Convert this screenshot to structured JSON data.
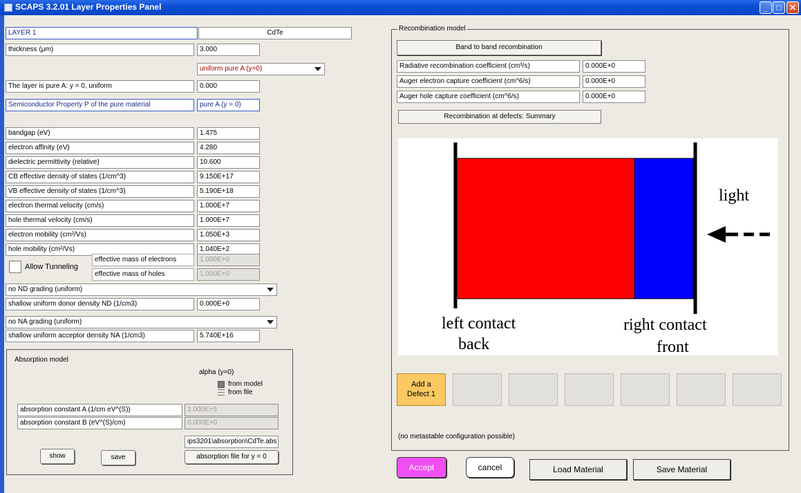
{
  "window": {
    "title": "SCAPS 3.2.01 Layer Properties Panel"
  },
  "layer": {
    "name": "LAYER 1",
    "material": "CdTe",
    "thickness_label": "thickness (μm)",
    "thickness_value": "3.000",
    "composition_select": "uniform pure A (y=0)",
    "pure_a_label": "The layer is pure A: y = 0, uniform",
    "pure_a_value": "0.000",
    "semiconductor_label": "Semiconductor Property P of the pure material",
    "semiconductor_value": "pure A (y = 0)"
  },
  "properties": [
    {
      "label": "bandgap (eV)",
      "value": "1.475"
    },
    {
      "label": "electron affinity (eV)",
      "value": "4.280"
    },
    {
      "label": "dielectric permittivity (relative)",
      "value": "10.600"
    },
    {
      "label": "CB effective density of states (1/cm^3)",
      "value": "9.150E+17"
    },
    {
      "label": "VB effective density of states (1/cm^3)",
      "value": "5.190E+18"
    },
    {
      "label": "electron thermal velocity (cm/s)",
      "value": "1.000E+7"
    },
    {
      "label": "hole thermal velocity (cm/s)",
      "value": "1.000E+7"
    },
    {
      "label": "electron mobility (cm²/Vs)",
      "value": "1.050E+3"
    },
    {
      "label": "hole mobility (cm²/Vs)",
      "value": "1.040E+2"
    }
  ],
  "tunneling": {
    "label": "Allow Tunneling",
    "electron_mass_label": "effective mass of electrons",
    "electron_mass_value": "1.000E+0",
    "hole_mass_label": "effective mass of holes",
    "hole_mass_value": "1.000E+0"
  },
  "doping": {
    "nd_grading": "no ND grading (uniform)",
    "nd_label": "shallow uniform donor density ND (1/cm3)",
    "nd_value": "0.000E+0",
    "na_grading": "no NA grading (uniform)",
    "na_label": "shallow uniform acceptor density NA (1/cm3)",
    "na_value": "5.740E+16"
  },
  "absorption": {
    "title": "Absorption model",
    "alpha_label": "alpha (y=0)",
    "from_model": "from model",
    "from_file": "from file",
    "const_a_label": "absorption constant A (1/cm eV^(S))",
    "const_a_value": "1.000E+5",
    "const_b_label": "absorption constant B (eV^(S)/cm)",
    "const_b_value": "0.000E+0",
    "file_path": "ips3201\\absorption\\CdTe.abs",
    "show_label": "show",
    "save_label": "save",
    "file_button_label": "absorption file for y = 0"
  },
  "recombination": {
    "title": "Recombination model",
    "mode_button": "Band to band recombination",
    "rows": [
      {
        "label": "Radiative recombination coefficient (cm³/s)",
        "value": "0.000E+0"
      },
      {
        "label": "Auger electron capture coefficient (cm^6/s)",
        "value": "0.000E+0"
      },
      {
        "label": "Auger hole capture coefficient (cm^6/s)",
        "value": "0.000E+0"
      }
    ],
    "defects_summary_button": "Recombination at defects: Summary"
  },
  "diagram": {
    "light_label": "light",
    "left_contact": "left contact",
    "left_sub": "back",
    "right_contact": "right contact",
    "right_sub": "front",
    "colors": {
      "layer": "#ff0000",
      "other_layer": "#0000ff"
    }
  },
  "defects": {
    "add_label_line1": "Add a",
    "add_label_line2": "Defect 1"
  },
  "metastable_note": "(no metastable configuration possible)",
  "actions": {
    "accept": "Accept",
    "cancel": "cancel",
    "load": "Load Material",
    "save": "Save Material"
  }
}
